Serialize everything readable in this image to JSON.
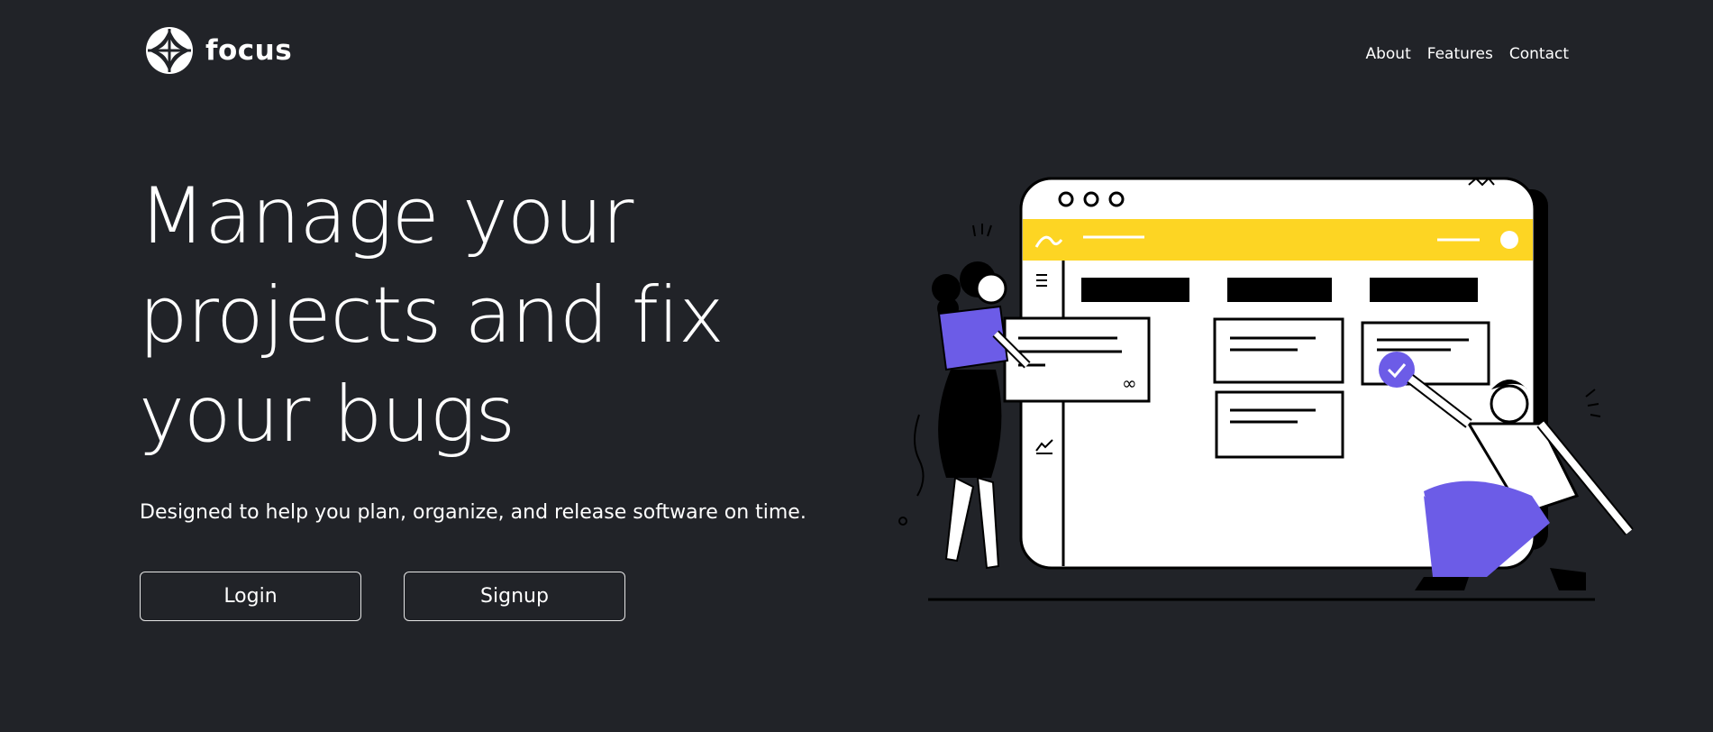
{
  "brand": {
    "name": "focus",
    "logo_icon": "focus-logo-icon"
  },
  "nav": {
    "items": [
      {
        "label": "About"
      },
      {
        "label": "Features"
      },
      {
        "label": "Contact"
      }
    ]
  },
  "hero": {
    "title": "Manage your projects and fix your bugs",
    "subtitle": "Designed to help you plan, organize, and release software on time.",
    "login_label": "Login",
    "signup_label": "Signup"
  },
  "illustration": {
    "description_icon": "kanban-board-illustration",
    "colors": {
      "accent_yellow": "#fdd523",
      "accent_purple": "#6c5ce7",
      "ink": "#000000",
      "paper": "#ffffff"
    }
  },
  "theme": {
    "background": "#212328",
    "text": "#ffffff"
  }
}
